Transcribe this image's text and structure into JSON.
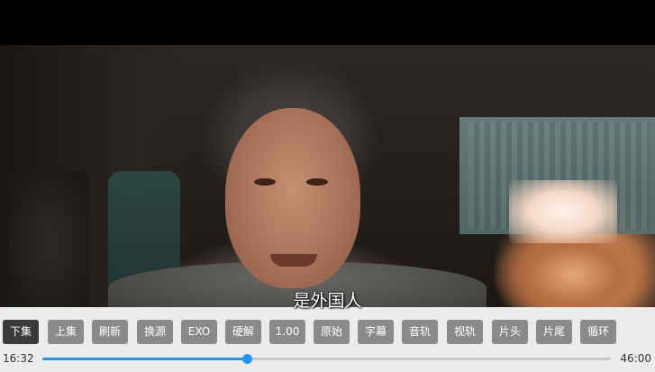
{
  "subtitle": "是外国人",
  "controls": {
    "buttons": [
      {
        "label": "下集",
        "active": true
      },
      {
        "label": "上集",
        "active": false
      },
      {
        "label": "刷新",
        "active": false
      },
      {
        "label": "换源",
        "active": false
      },
      {
        "label": "EXO",
        "active": false
      },
      {
        "label": "硬解",
        "active": false
      },
      {
        "label": "1.00",
        "active": false
      },
      {
        "label": "原始",
        "active": false
      },
      {
        "label": "字幕",
        "active": false
      },
      {
        "label": "音轨",
        "active": false
      },
      {
        "label": "视轨",
        "active": false
      },
      {
        "label": "片头",
        "active": false
      },
      {
        "label": "片尾",
        "active": false
      },
      {
        "label": "循环",
        "active": false
      }
    ],
    "time_current": "16:32",
    "time_total": "46:00",
    "progress_fraction": 0.359
  },
  "colors": {
    "accent": "#2196f3",
    "button_bg": "#8a8a8a",
    "button_active_bg": "#3a3a3a",
    "controls_bg": "#ececec"
  }
}
